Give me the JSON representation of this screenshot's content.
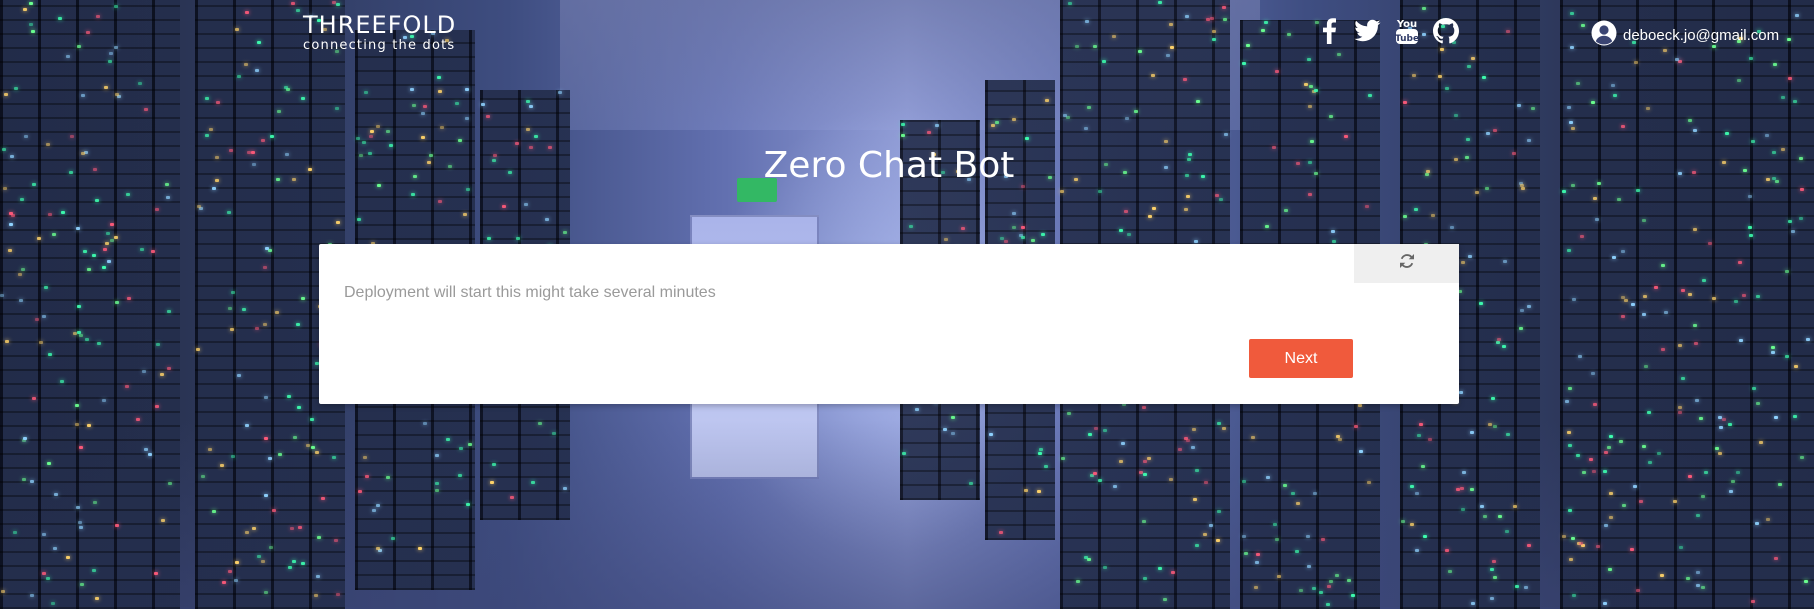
{
  "header": {
    "logo_title": "THREEFOLD",
    "logo_tagline": "connecting the dots",
    "socials": [
      {
        "icon": "facebook-icon"
      },
      {
        "icon": "twitter-icon"
      },
      {
        "icon": "youtube-icon"
      },
      {
        "icon": "github-icon"
      }
    ],
    "user": {
      "icon": "user-circle-icon",
      "email": "deboeck.jo@gmail.com"
    }
  },
  "main": {
    "title": "Zero Chat Bot",
    "card": {
      "refresh_icon": "refresh-icon",
      "message": "Deployment will start this might take several minutes",
      "next_label": "Next"
    }
  },
  "colors": {
    "accent": "#f05a3c",
    "card_bg": "#ffffff",
    "message_text": "#9a9a9a",
    "refresh_bg": "#efefef"
  }
}
